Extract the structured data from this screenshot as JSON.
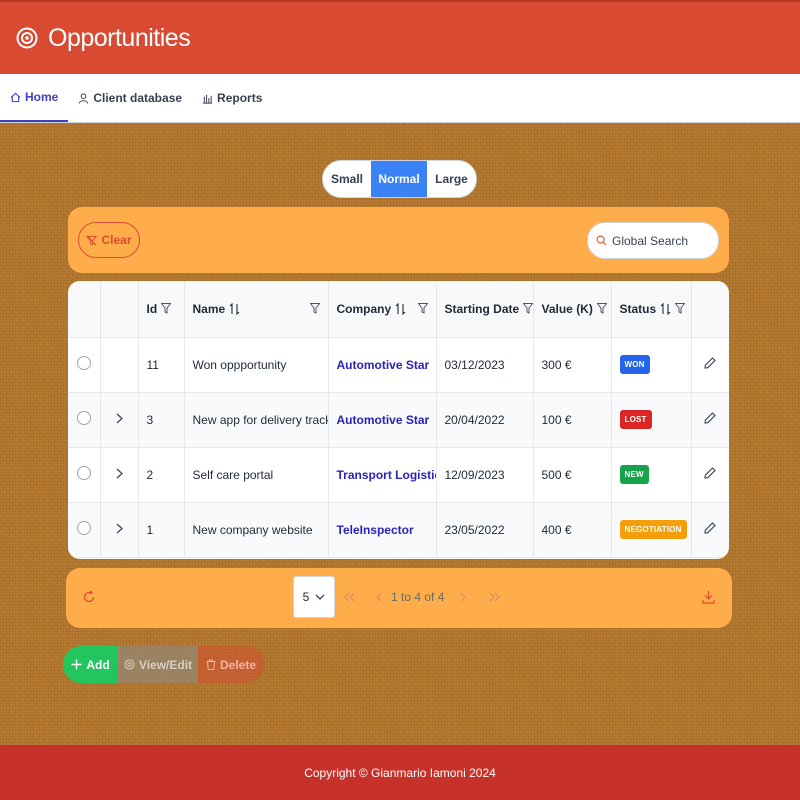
{
  "app": {
    "title": "Opportunities"
  },
  "nav": {
    "items": [
      {
        "label": "Home",
        "active": true,
        "icon": "home-icon"
      },
      {
        "label": "Client database",
        "active": false,
        "icon": "user-icon"
      },
      {
        "label": "Reports",
        "active": false,
        "icon": "bar-chart-icon"
      }
    ]
  },
  "size_toggle": {
    "options": [
      "Small",
      "Normal",
      "Large"
    ],
    "selected": "Normal"
  },
  "toolbar": {
    "clear_label": "Clear",
    "search_placeholder": "Global Search"
  },
  "table": {
    "columns": [
      {
        "label": "Id",
        "sortable": false,
        "filter": true
      },
      {
        "label": "Name",
        "sortable": true,
        "filter": true
      },
      {
        "label": "Company",
        "sortable": true,
        "filter": true
      },
      {
        "label": "Starting Date",
        "sortable": false,
        "filter": true
      },
      {
        "label": "Value (K)",
        "sortable": false,
        "filter": true
      },
      {
        "label": "Status",
        "sortable": true,
        "filter": true
      }
    ],
    "rows": [
      {
        "id": "11",
        "name": "Won oppportunity",
        "company": "Automotive Star",
        "date": "03/12/2023",
        "value": "300 €",
        "status": "WON",
        "expandable": false
      },
      {
        "id": "3",
        "name": "New app for delivery tracking",
        "company": "Automotive Star",
        "date": "20/04/2022",
        "value": "100 €",
        "status": "LOST",
        "expandable": true
      },
      {
        "id": "2",
        "name": "Self care portal",
        "company": "Transport Logistics",
        "date": "12/09/2023",
        "value": "500 €",
        "status": "NEW",
        "expandable": true
      },
      {
        "id": "1",
        "name": "New company website",
        "company": "TeleInspector",
        "date": "23/05/2022",
        "value": "400 €",
        "status": "NEGOTIATION",
        "expandable": true
      }
    ]
  },
  "status_colors": {
    "WON": "#2563eb",
    "LOST": "#dc2626",
    "NEW": "#16a34a",
    "NEGOTIATION": "#f59e0b"
  },
  "paginator": {
    "rows_per_page": "5",
    "report": "1 to 4 of 4"
  },
  "actions": {
    "add_label": "Add",
    "view_label": "View/Edit",
    "delete_label": "Delete"
  },
  "footer": {
    "text": "Copyright © Gianmario Iamoni 2024"
  },
  "colors": {
    "header": "#d94a33",
    "accent": "#3b3fc2",
    "panel": "#ffad4a",
    "footer": "#c6322a"
  }
}
